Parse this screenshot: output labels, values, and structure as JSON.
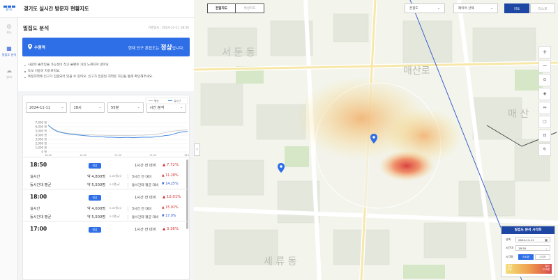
{
  "app": {
    "logo_text": "경기도",
    "title": "경기도 실시간 방문자 현황지도"
  },
  "rail": [
    {
      "label": "지도",
      "icon": "map-pin-icon",
      "glyph": "◎"
    },
    {
      "label": "밀집도 분석",
      "icon": "density-analysis-icon",
      "glyph": "▦"
    },
    {
      "label": "날씨",
      "icon": "weather-icon",
      "glyph": "☁"
    }
  ],
  "panel": {
    "title": "밀집도 분석",
    "updated": "기준일시 : 2024-11-11 18:50",
    "station": "수원역",
    "status_prefix": "현재 인구 혼잡도는",
    "status_value": "정상",
    "status_suffix": "입니다.",
    "notes": [
      "사람이 몰려있을 가능성이 적고 불편은 거의 느껴지지 않아요.",
      "도보 이동이 자유로워요.",
      "특정지역에 인구가 집중되어 있을 수 있어요. 인구가 집중된 지역은 하단을 통해 확인해주세요."
    ]
  },
  "filters": {
    "date": "2024-11-11",
    "hour": "18시",
    "minute": "55분",
    "mode": "시간 분석"
  },
  "chart_data": {
    "type": "line",
    "legend": [
      "평균",
      "실시간"
    ],
    "ylim": [
      0,
      7000
    ],
    "yticks": [
      "7,000 명",
      "6,000 명",
      "5,000 명",
      "4,000 명",
      "3,000 명",
      "2,000 명",
      "1,000 명",
      "0 명"
    ],
    "xticks": [
      "18:00",
      "15:00",
      "17:00",
      "17:30",
      "18:00"
    ],
    "x": [
      0,
      1,
      2,
      3,
      4,
      5,
      6,
      7,
      8,
      9,
      10,
      11,
      12,
      13,
      14,
      15,
      16,
      17,
      18,
      19,
      20,
      21,
      22,
      23,
      24,
      25,
      26,
      27,
      28,
      29,
      30,
      31
    ],
    "series": [
      {
        "name": "평균",
        "color": "#c5c5c5",
        "values": [
          6300,
          5600,
          5000,
          4700,
          4500,
          4400,
          4300,
          4200,
          4150,
          4100,
          4050,
          4000,
          4000,
          3950,
          3950,
          3950,
          3950,
          3950,
          3950,
          3950,
          4000,
          4000,
          4050,
          4100,
          4200,
          4400,
          4600,
          4800,
          5000,
          5100,
          5200,
          5300
        ]
      },
      {
        "name": "실시간",
        "color": "#4a8fe0",
        "values": [
          6400,
          5500,
          4900,
          4600,
          4400,
          4200,
          4100,
          4000,
          3900,
          3800,
          3700,
          3650,
          3600,
          3500,
          3500,
          3450,
          3400,
          3450,
          3450,
          3400,
          3450,
          3500,
          3500,
          3500,
          3600,
          3700,
          3900,
          4000,
          4300,
          4600,
          4800,
          4900
        ]
      }
    ]
  },
  "rows": [
    {
      "time": "18:50",
      "badge": "정상",
      "compare": "1시간 전 대비",
      "pct": "7.72%",
      "dir": "up",
      "details": [
        {
          "label": "실시간",
          "value": "약 4,800명",
          "density": "0.09명/㎡",
          "compare": "3시간 전 대비",
          "pct": "11.28%",
          "dir": "up"
        },
        {
          "label": "동시간대 평균",
          "value": "약 5,500명",
          "density": "0.2명/㎡",
          "compare": "동시간대 평균 대비",
          "pct": "14.25%",
          "dir": "down"
        }
      ]
    },
    {
      "time": "18:00",
      "badge": "정상",
      "compare": "1시간 전 대비",
      "pct": "10.01%",
      "dir": "up",
      "details": [
        {
          "label": "실시간",
          "value": "약 4,600명",
          "density": "0.09명/㎡",
          "compare": "3시간 전 대비",
          "pct": "15.92%",
          "dir": "up"
        },
        {
          "label": "동시간대 평균",
          "value": "약 5,500명",
          "density": "0.2명/㎡",
          "compare": "동시간대 평균 대비",
          "pct": "17.0%",
          "dir": "down"
        }
      ]
    },
    {
      "time": "17:00",
      "badge": "정상",
      "compare": "1시간 전 대비",
      "pct": "3.36%",
      "dir": "up",
      "details": []
    }
  ],
  "map": {
    "toggle_on": "전일지도",
    "toggle_off": "위성지도",
    "dropdown_1": "혼잡도",
    "dropdown_2": "레이어 선택",
    "tab_on": "지도",
    "tab_off": "리스트",
    "labels": [
      "서 둔 동",
      "매 산",
      "세 류 동",
      "매산로"
    ]
  },
  "legend": {
    "title": "밀집도 분석 시각화",
    "date_label": "날짜",
    "date_value": "2024-11-11",
    "time_label": "시간대",
    "time_value": "18:50",
    "viz_label": "시각화",
    "chip_on": "히트맵",
    "chip_off": "그리드",
    "low": "여유",
    "low_sub": "0명",
    "high": "밀집",
    "high_sub": "226명"
  }
}
